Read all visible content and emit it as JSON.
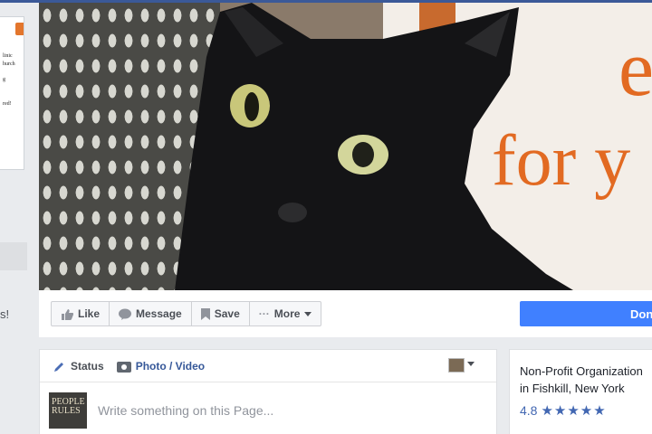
{
  "left": {
    "flyer_lines": [
      "linic",
      "hurch",
      "g",
      "red!"
    ],
    "fragment": "s!"
  },
  "cover": {
    "text_line1": "e",
    "text_line2": "for y"
  },
  "actions": {
    "like": "Like",
    "message": "Message",
    "save": "Save",
    "more": "More",
    "primary": "Don"
  },
  "composer": {
    "tab_status": "Status",
    "tab_photo": "Photo / Video",
    "placeholder": "Write something on this Page...",
    "avatar_text": "PEOPLE RULES"
  },
  "info": {
    "category": "Non-Profit Organization",
    "location": "in Fishkill, New York",
    "rating": "4.8",
    "stars": "★★★★★"
  },
  "colors": {
    "brand": "#3b5998",
    "primary_button": "#4080ff",
    "link": "#365899",
    "cover_text": "#e26a22"
  }
}
